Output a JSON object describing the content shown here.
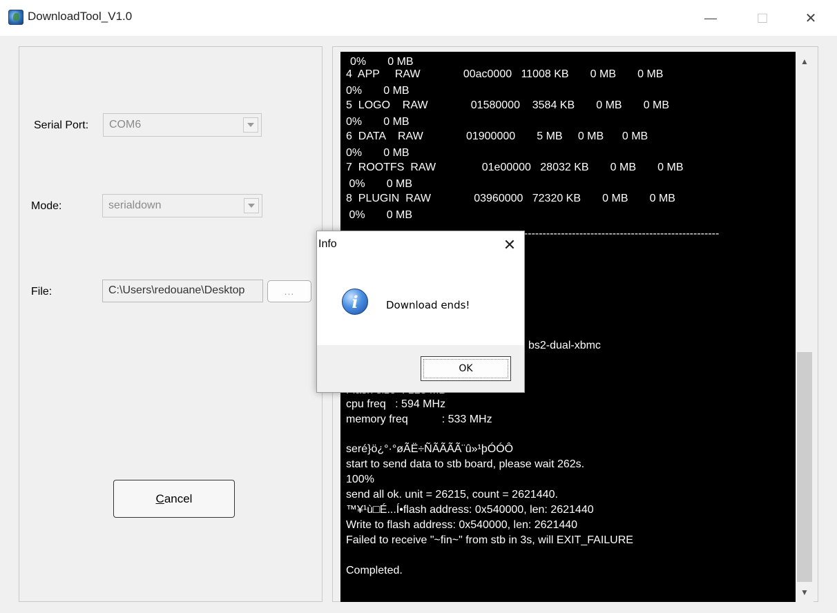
{
  "window": {
    "title": "DownloadTool_V1.0",
    "minimize_glyph": "—",
    "maximize_glyph": "□",
    "close_glyph": "✕"
  },
  "form": {
    "serial_port_label": "Serial Port:",
    "serial_port_value": "COM6",
    "mode_label": "Mode:",
    "mode_value": "serialdown",
    "file_label": "File:",
    "file_value": "C:\\Users\\redouane\\Desktop",
    "browse_label": "...",
    "cancel_label": "Cancel"
  },
  "console": {
    "lines": [
      "0%       0 MB",
      "4  APP     RAW              00ac0000   11008 KB       0 MB       0 MB",
      "0%       0 MB",
      "5  LOGO    RAW              01580000    3584 KB       0 MB       0 MB",
      "0%       0 MB",
      "6  DATA    RAW              01900000       5 MB     0 MB      0 MB",
      "0%       0 MB",
      "7  ROOTFS  RAW               01e00000   28032 KB       0 MB       0 MB",
      " 0%       0 MB",
      "8  PLUGIN  RAW              03960000   72320 KB       0 MB       0 MB",
      " 0%       0 MB",
      "-----------------------------------------------------------------------",
      "bs2-dual-xbmc",
      "Flash size  : 128 MB",
      "cpu freq   : 594 MHz",
      "memory freq           : 533 MHz",
      "seré}ö¿°·°øÃË÷ÑÃÃÃÃ¨û»¹þÓÓÔ",
      "start to send data to stb board, please wait 262s.",
      "100%",
      "send all ok. unit = 26215, count = 2621440.",
      "™¥¹ù□É...Í•flash address: 0x540000, len: 2621440",
      "Write to flash address: 0x540000, len: 2621440",
      "Failed to receive \"~fin~\" from stb in 3s, will EXIT_FAILURE",
      "Completed."
    ]
  },
  "dialog": {
    "title": "Info",
    "message": "Download ends!",
    "ok_label": "OK",
    "close_glyph": "✕",
    "icon_glyph": "i"
  }
}
